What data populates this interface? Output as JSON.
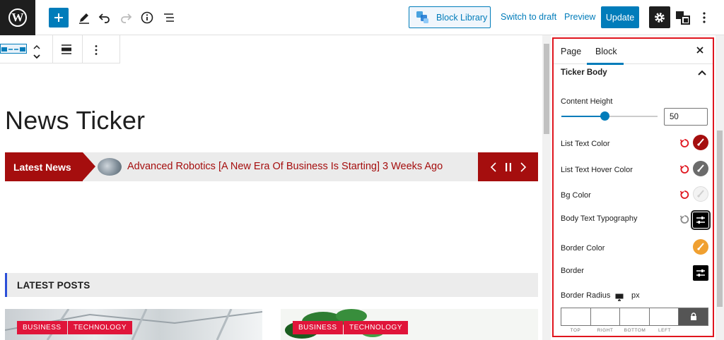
{
  "topbar": {
    "logo_letter": "W",
    "block_library_label": "Block Library",
    "switch_draft_label": "Switch to draft",
    "preview_label": "Preview",
    "update_label": "Update"
  },
  "editor": {
    "page_title": "News Ticker",
    "ticker": {
      "label": "Latest News",
      "headline": "Advanced Robotics [A New Era Of Business Is Starting]",
      "date": "3 Weeks Ago"
    },
    "posts_heading": "LATEST POSTS",
    "post_cards": [
      {
        "tags": [
          "BUSINESS",
          "TECHNOLOGY"
        ]
      },
      {
        "tags": [
          "BUSINESS",
          "TECHNOLOGY"
        ]
      }
    ]
  },
  "sidebar": {
    "tabs": [
      "Page",
      "Block"
    ],
    "active_tab": "Block",
    "section_title": "Ticker Body",
    "content_height_label": "Content Height",
    "content_height_value": "50",
    "content_height_fraction": 0.5,
    "list_text_color_label": "List Text Color",
    "list_text_hover_color_label": "List Text Hover Color",
    "bg_color_label": "Bg Color",
    "body_text_typography_label": "Body Text Typography",
    "border_color_label": "Border Color",
    "border_label": "Border",
    "border_radius_label": "Border Radius",
    "border_radius_unit": "px",
    "radius_sides": [
      "TOP",
      "RIGHT",
      "BOTTOM",
      "LEFT"
    ]
  },
  "colors": {
    "accent": "#007cba",
    "ticker_red": "#a50e0e",
    "tag_red": "#e0153a",
    "list_text_color": "#a50e0e",
    "list_text_hover_color": "#6b6b6b",
    "bg_color": "#f3f3f3",
    "border_color": "#f0a030",
    "highlight_frame": "#e0151e"
  }
}
